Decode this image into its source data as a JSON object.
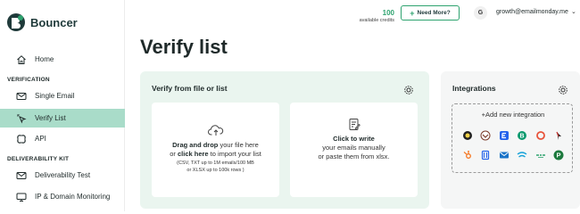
{
  "brand": {
    "name": "Bouncer",
    "color": "#2ea36f"
  },
  "sidebar": {
    "items": [
      {
        "label": "Home",
        "icon": "home-icon"
      },
      {
        "label": "Single Email",
        "icon": "envelope-icon"
      },
      {
        "label": "Verify List",
        "icon": "mouse-click-icon",
        "active": true
      },
      {
        "label": "API",
        "icon": "api-icon"
      },
      {
        "label": "Deliverability Test",
        "icon": "envelope-icon"
      },
      {
        "label": "IP & Domain Monitoring",
        "icon": "monitor-icon"
      }
    ],
    "sections": {
      "verification": "VERIFICATION",
      "deliverability": "DELIVERABILITY KIT"
    }
  },
  "topbar": {
    "credits_value": "100",
    "credits_label": "available credits",
    "need_more_label": "Need More?",
    "avatar_initial": "G",
    "email": "growth@emailmonday.me"
  },
  "page": {
    "title": "Verify list"
  },
  "verify": {
    "title": "Verify from file or list",
    "upload": {
      "drag": "Drag and drop",
      "line1_rest": " your file here",
      "or": "or ",
      "click_here": "click here",
      "line2_rest": " to import your list",
      "formats1": "(CSV, TXT up to 1M emails/100 MB",
      "formats2": "or XLSX up to 100k rows )"
    },
    "write": {
      "cta": "Click to write",
      "line1": "your emails manually",
      "line2": "or paste them from xlsx."
    }
  },
  "integrations": {
    "title": "Integrations",
    "add_label": "+Add new integration",
    "row1": [
      "mailchimp-icon",
      "campaign-monitor-icon",
      "emailoctopus-icon",
      "brevo-icon",
      "activecampaign-icon",
      "klaviyo-icon"
    ],
    "row2": [
      "hubspot-icon",
      "bookmark-icon",
      "mailerlite-icon",
      "sendgrid-icon",
      "stripe-wave-icon",
      "pipedrive-icon"
    ]
  }
}
